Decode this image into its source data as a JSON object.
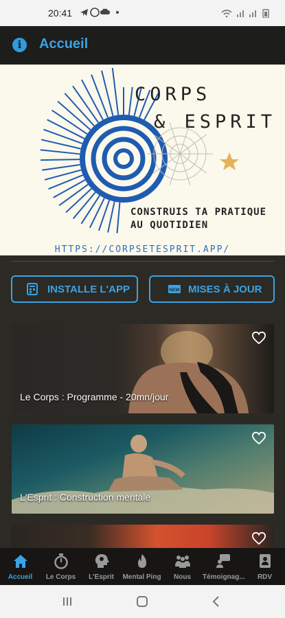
{
  "status": {
    "time": "20:41",
    "left_icons": "telegram whatsapp cloud dot",
    "right_icons": "wifi signal signal battery"
  },
  "appbar": {
    "title": "Accueil",
    "icon": "info-icon"
  },
  "banner": {
    "brand_line1": "CORPS",
    "brand_line2": "& ESPRIT",
    "tagline_line1": "CONSTRUIS TA PRATIQUE",
    "tagline_line2": "AU QUOTIDIEN",
    "url": "HTTPS://CORPSETESPRIT.APP/"
  },
  "buttons": {
    "install": "INSTALLE L'APP",
    "updates": "MISES À JOUR",
    "updates_badge": "NEW"
  },
  "cards": [
    {
      "title": "Le Corps : Programme - 20mn/jour",
      "icon": "heart-outline-icon"
    },
    {
      "title": "L'Esprit : Construction mentale",
      "icon": "heart-outline-icon"
    },
    {
      "title": "",
      "icon": "heart-outline-icon"
    }
  ],
  "nav": [
    {
      "label": "Accueil",
      "icon": "home-icon",
      "active": true
    },
    {
      "label": "Le Corps",
      "icon": "stopwatch-icon"
    },
    {
      "label": "L'Esprit",
      "icon": "head-icon"
    },
    {
      "label": "Mental Ping",
      "icon": "flame-icon"
    },
    {
      "label": "Nous",
      "icon": "group-icon"
    },
    {
      "label": "Témoignag...",
      "icon": "chat-icon"
    },
    {
      "label": "RDV",
      "icon": "contact-card-icon"
    }
  ],
  "colors": {
    "accent": "#3aa3e6",
    "background": "#2c2a24",
    "appbar": "#1d1d1b",
    "banner": "#fbf8ec",
    "logo_blue": "#1f5bb0",
    "star": "#e3b35a"
  }
}
